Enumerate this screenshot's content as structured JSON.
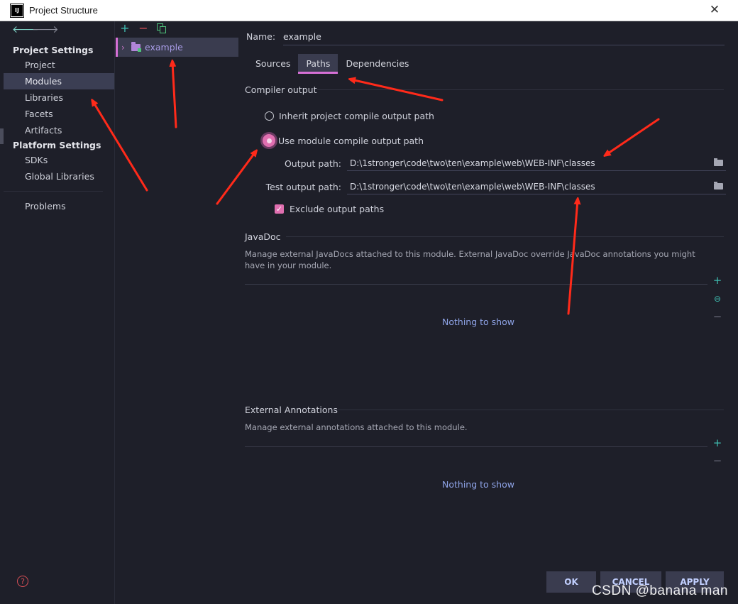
{
  "window": {
    "title": "Project Structure",
    "logo_text": "IJ"
  },
  "sidebar": {
    "project_settings_heading": "Project Settings",
    "project_items": [
      {
        "label": "Project"
      },
      {
        "label": "Modules"
      },
      {
        "label": "Libraries"
      },
      {
        "label": "Facets"
      },
      {
        "label": "Artifacts"
      }
    ],
    "platform_settings_heading": "Platform Settings",
    "platform_items": [
      {
        "label": "SDKs"
      },
      {
        "label": "Global Libraries"
      }
    ],
    "problems_label": "Problems",
    "selected": "Modules"
  },
  "modules": {
    "items": [
      {
        "label": "example"
      }
    ]
  },
  "details": {
    "name_label": "Name:",
    "name_value": "example",
    "tabs": [
      {
        "label": "Sources"
      },
      {
        "label": "Paths"
      },
      {
        "label": "Dependencies"
      }
    ],
    "active_tab": "Paths",
    "compiler_output": {
      "title": "Compiler output",
      "inherit_label": "Inherit project compile output path",
      "use_module_label": "Use module compile output path",
      "selected_option": "use_module",
      "output_path_label": "Output path:",
      "output_path_value": "D:\\1stronger\\code\\two\\ten\\example\\web\\WEB-INF\\classes",
      "test_output_path_label": "Test output path:",
      "test_output_path_value": "D:\\1stronger\\code\\two\\ten\\example\\web\\WEB-INF\\classes",
      "exclude_label": "Exclude output paths",
      "exclude_checked": true
    },
    "javadoc": {
      "title": "JavaDoc",
      "description": "Manage external JavaDocs attached to this module. External JavaDoc override JavaDoc annotations you might have in your module.",
      "empty_text": "Nothing to show"
    },
    "external_annotations": {
      "title": "External Annotations",
      "description": "Manage external annotations attached to this module.",
      "empty_text": "Nothing to show"
    }
  },
  "buttons": {
    "ok": "OK",
    "cancel": "CANCEL",
    "apply": "APPLY"
  },
  "watermark": "CSDN @banana man",
  "colors": {
    "background": "#1e1f29",
    "accent_pink": "#e06fb0",
    "selection": "#3b3e53",
    "link_blue": "#8fa4e8",
    "annotation_red": "#ff2a1a"
  }
}
